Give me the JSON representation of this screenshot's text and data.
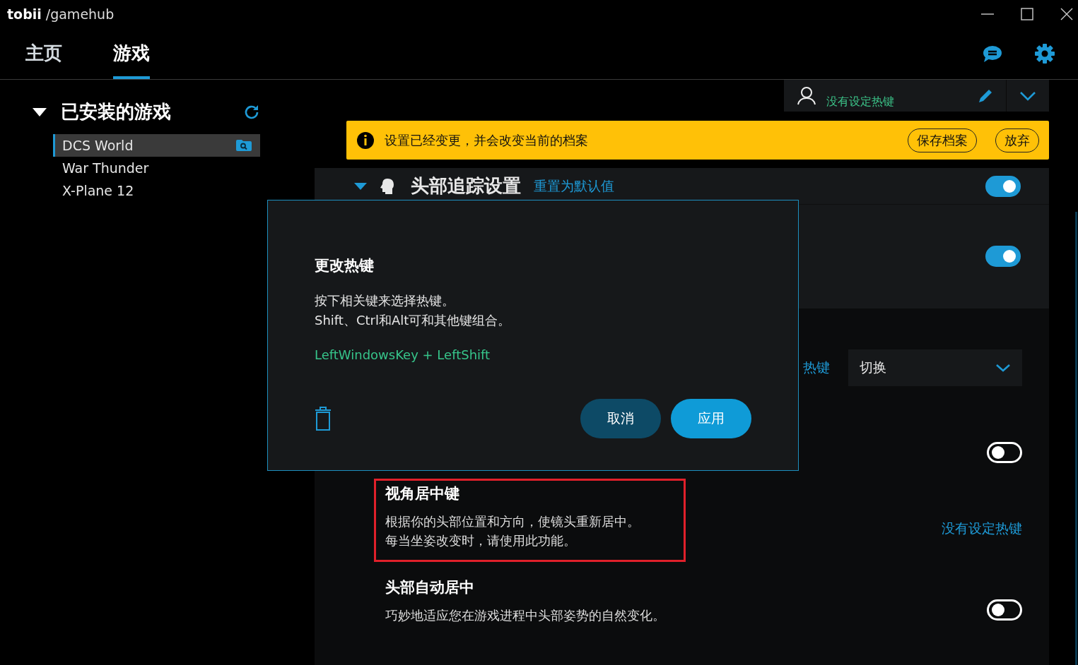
{
  "app": {
    "logo": "tobii",
    "path": "/gamehub"
  },
  "tabs": [
    {
      "label": "主页",
      "selected": false
    },
    {
      "label": "游戏",
      "selected": true
    }
  ],
  "sidebar": {
    "heading": "已安装的游戏",
    "expanded": true,
    "games": [
      {
        "name": "DCS World",
        "selected": true
      },
      {
        "name": "War Thunder",
        "selected": false
      },
      {
        "name": "X-Plane 12",
        "selected": false
      }
    ]
  },
  "profile": {
    "hotkey": "没有设定热键"
  },
  "banner": {
    "message": "设置已经变更，并会改变当前的档案",
    "buttons": [
      "保存档案",
      "放弃"
    ]
  },
  "head_tracking": {
    "title": "头部追踪设置",
    "reset_link": "重置为默认值",
    "expanded": true,
    "on": true,
    "second_toggle_on": true
  },
  "settings": [
    {
      "kind": "dropdown",
      "label": "热键",
      "value": "切换"
    },
    {
      "kind": "toggle",
      "on": false
    },
    {
      "kind": "hotkey",
      "title": "视角居中键",
      "description": [
        "根据你的头部位置和方向，使镜头重新居中。",
        "每当坐姿改变时，请使用此功能。"
      ],
      "hotkey": "没有设定热键",
      "highlighted": true
    },
    {
      "kind": "toggle",
      "title": "头部自动居中",
      "description": [
        "巧妙地适应您在游戏进程中头部姿势的自然变化。"
      ],
      "on": false
    }
  ],
  "dialog": {
    "title": "更改热键",
    "instructions": [
      "按下相关键来选择热键。",
      "Shift、Ctrl和Alt可和其他键组合。"
    ],
    "keys": "LeftWindowsKey + LeftShift",
    "buttons": [
      {
        "label": "取消",
        "kind": "secondary"
      },
      {
        "label": "应用",
        "kind": "primary"
      }
    ]
  }
}
